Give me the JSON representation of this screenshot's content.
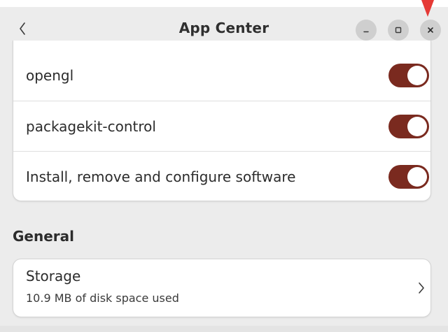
{
  "window": {
    "title": "App Center"
  },
  "titlebar": {
    "back_icon": "chevron-left-icon",
    "minimize_icon": "minimize-icon",
    "maximize_icon": "maximize-icon",
    "close_icon": "close-icon"
  },
  "permissions": {
    "items": [
      {
        "label": "opengl",
        "enabled": true
      },
      {
        "label": "packagekit-control",
        "enabled": true
      },
      {
        "label": "Install, remove and configure software",
        "enabled": true
      }
    ]
  },
  "general": {
    "heading": "General",
    "storage": {
      "title": "Storage",
      "subtitle": "10.9 MB of disk space used",
      "icon": "chevron-right-icon"
    }
  },
  "colors": {
    "toggle_on": "#7a2a1f",
    "window_bg": "#ececec",
    "card_bg": "#ffffff",
    "cursor": "#e53935"
  }
}
